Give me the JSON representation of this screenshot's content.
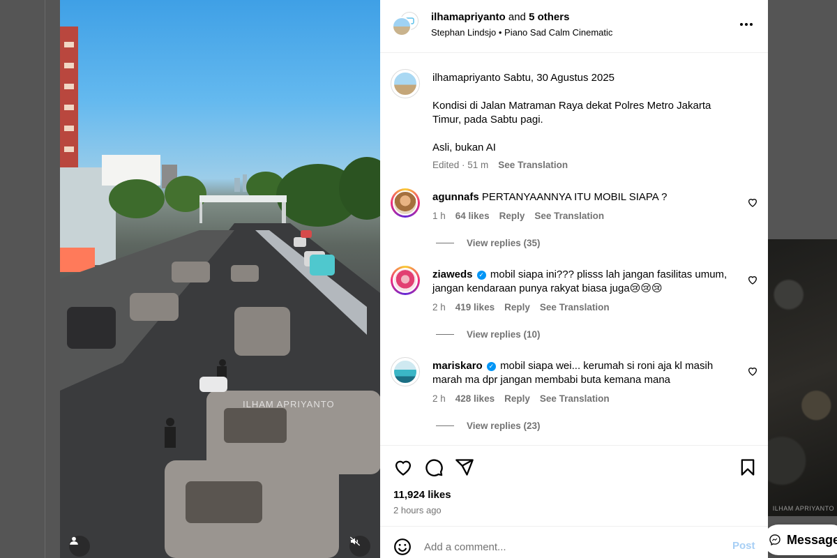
{
  "post": {
    "authors_main": "ilhamapriyanto",
    "authors_and": " and ",
    "authors_others": "5 others",
    "audio_artist": "Stephan Lindsjo",
    "audio_separator": " • ",
    "audio_track": "Piano Sad Calm Cinematic",
    "media_watermark": "ILHAM APRIYANTO",
    "caption": {
      "username": "ilhamapriyanto",
      "date": "Sabtu, 30 Agustus 2025",
      "paragraph1": "Kondisi di Jalan Matraman Raya dekat Polres Metro Jakarta Timur, pada Sabtu pagi.",
      "paragraph2": "Asli, bukan AI",
      "edited": "Edited · 51 m",
      "see_translation": "See Translation"
    },
    "comments": [
      {
        "username": "agunnafs",
        "verified": false,
        "text": "PERTANYAANNYA ITU MOBIL SIAPA ?",
        "time": "1 h",
        "likes": "64 likes",
        "reply": "Reply",
        "see_translation": "See Translation",
        "view_replies": "View replies (35)"
      },
      {
        "username": "ziaweds",
        "verified": true,
        "text": "mobil siapa ini??? plisss lah jangan fasilitas umum, jangan kendaraan punya rakyat biasa juga😢😢😢",
        "time": "2 h",
        "likes": "419 likes",
        "reply": "Reply",
        "see_translation": "See Translation",
        "view_replies": "View replies (10)"
      },
      {
        "username": "mariskaro",
        "verified": true,
        "text": "mobil siapa wei... kerumah si roni aja kl masih marah ma dpr jangan membabi buta kemana mana",
        "time": "2 h",
        "likes": "428 likes",
        "reply": "Reply",
        "see_translation": "See Translation",
        "view_replies": "View replies (23)"
      }
    ],
    "likes_count": "11,924 likes",
    "posted_ago": "2 hours ago",
    "comment_placeholder": "Add a comment...",
    "post_button": "Post"
  },
  "background": {
    "next_post_watermark": "ILHAM APRIYANTO",
    "messages_label": "Messages"
  },
  "icons": [
    "heart-icon",
    "comment-icon",
    "share-icon",
    "bookmark-icon",
    "more-icon",
    "emoji-icon",
    "user-tag-icon",
    "mute-icon",
    "messenger-icon",
    "verified-badge"
  ],
  "colors": {
    "link_blue": "#0095f6",
    "post_disabled": "#a7cff5",
    "muted_text": "#737373"
  }
}
